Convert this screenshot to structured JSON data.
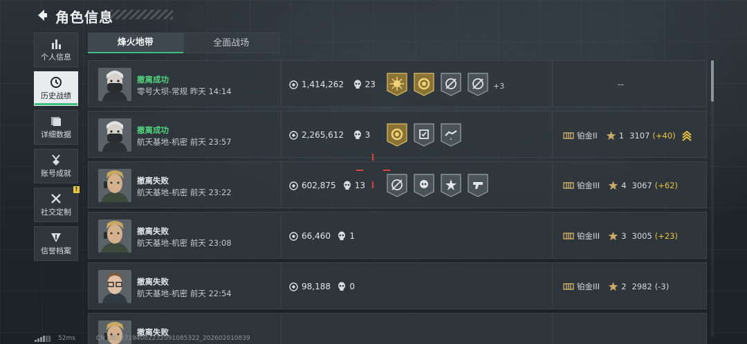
{
  "header": {
    "title": "角色信息"
  },
  "sidebar": {
    "items": [
      {
        "label": "个人信息",
        "icon": "bar-chart-icon",
        "active": false
      },
      {
        "label": "历史战绩",
        "icon": "history-icon",
        "active": true
      },
      {
        "label": "详细数据",
        "icon": "folder-icon",
        "active": false
      },
      {
        "label": "账号成就",
        "icon": "medal-icon",
        "active": false
      },
      {
        "label": "社交定制",
        "icon": "tools-icon",
        "active": false,
        "badge": "!"
      },
      {
        "label": "信誉档案",
        "icon": "shield-icon",
        "active": false
      }
    ]
  },
  "tabs": [
    {
      "label": "烽火地带",
      "active": true
    },
    {
      "label": "全面战场",
      "active": false
    }
  ],
  "matches": [
    {
      "status": "撤离成功",
      "success": true,
      "map": "零号大坝-常规",
      "time": "昨天 14:14",
      "value": "1,414,262",
      "kills": "23",
      "badges": [
        "gold-sun",
        "gold-ring",
        "grey-target",
        "grey-target"
      ],
      "badge_more": "+3",
      "rank": null,
      "dash": "--",
      "avatar": "masked"
    },
    {
      "status": "撤离成功",
      "success": true,
      "map": "航天基地-机密",
      "time": "前天 23:57",
      "value": "2,265,612",
      "kills": "3",
      "badges": [
        "gold-ring",
        "grey-shield",
        "grey-hand"
      ],
      "badge_more": "",
      "rank": {
        "tier": "铂金II",
        "stars": "1",
        "score": "3107",
        "delta": "(+40)",
        "delta_positive": true,
        "chevron": true
      },
      "avatar": "masked"
    },
    {
      "status": "撤离失败",
      "success": false,
      "map": "航天基地-机密",
      "time": "前天 23:22",
      "value": "602,875",
      "kills": "13",
      "badges": [
        "grey-target",
        "grey-skull",
        "grey-star",
        "grey-gun"
      ],
      "badge_more": "",
      "rank": {
        "tier": "铂金III",
        "stars": "4",
        "score": "3067",
        "delta": "(+62)",
        "delta_positive": true,
        "chevron": false
      },
      "avatar": "blond"
    },
    {
      "status": "撤离失败",
      "success": false,
      "map": "航天基地-机密",
      "time": "前天 23:08",
      "value": "66,460",
      "kills": "1",
      "badges": [],
      "badge_more": "",
      "rank": {
        "tier": "铂金III",
        "stars": "3",
        "score": "3005",
        "delta": "(+23)",
        "delta_positive": true,
        "chevron": false
      },
      "avatar": "blond"
    },
    {
      "status": "撤离失败",
      "success": false,
      "map": "航天基地-机密",
      "time": "前天 22:54",
      "value": "98,188",
      "kills": "0",
      "badges": [],
      "badge_more": "",
      "rank": {
        "tier": "铂金III",
        "stars": "2",
        "score": "2982",
        "delta": "(-3)",
        "delta_positive": false,
        "chevron": false
      },
      "avatar": "glasses"
    },
    {
      "status": "撤离失败",
      "success": false,
      "map": "",
      "time": "",
      "value": "",
      "kills": "",
      "badges": [],
      "badge_more": "",
      "rank": null,
      "dash": "",
      "avatar": "blond"
    }
  ],
  "footer": {
    "ping": "52ms",
    "uid": "CN UID:2719400223209108532​2_202602010839"
  },
  "colors": {
    "success": "#54d27e",
    "accent": "#3fbf7f",
    "gold": "#e8c540",
    "crosshair": "#e0403a"
  }
}
